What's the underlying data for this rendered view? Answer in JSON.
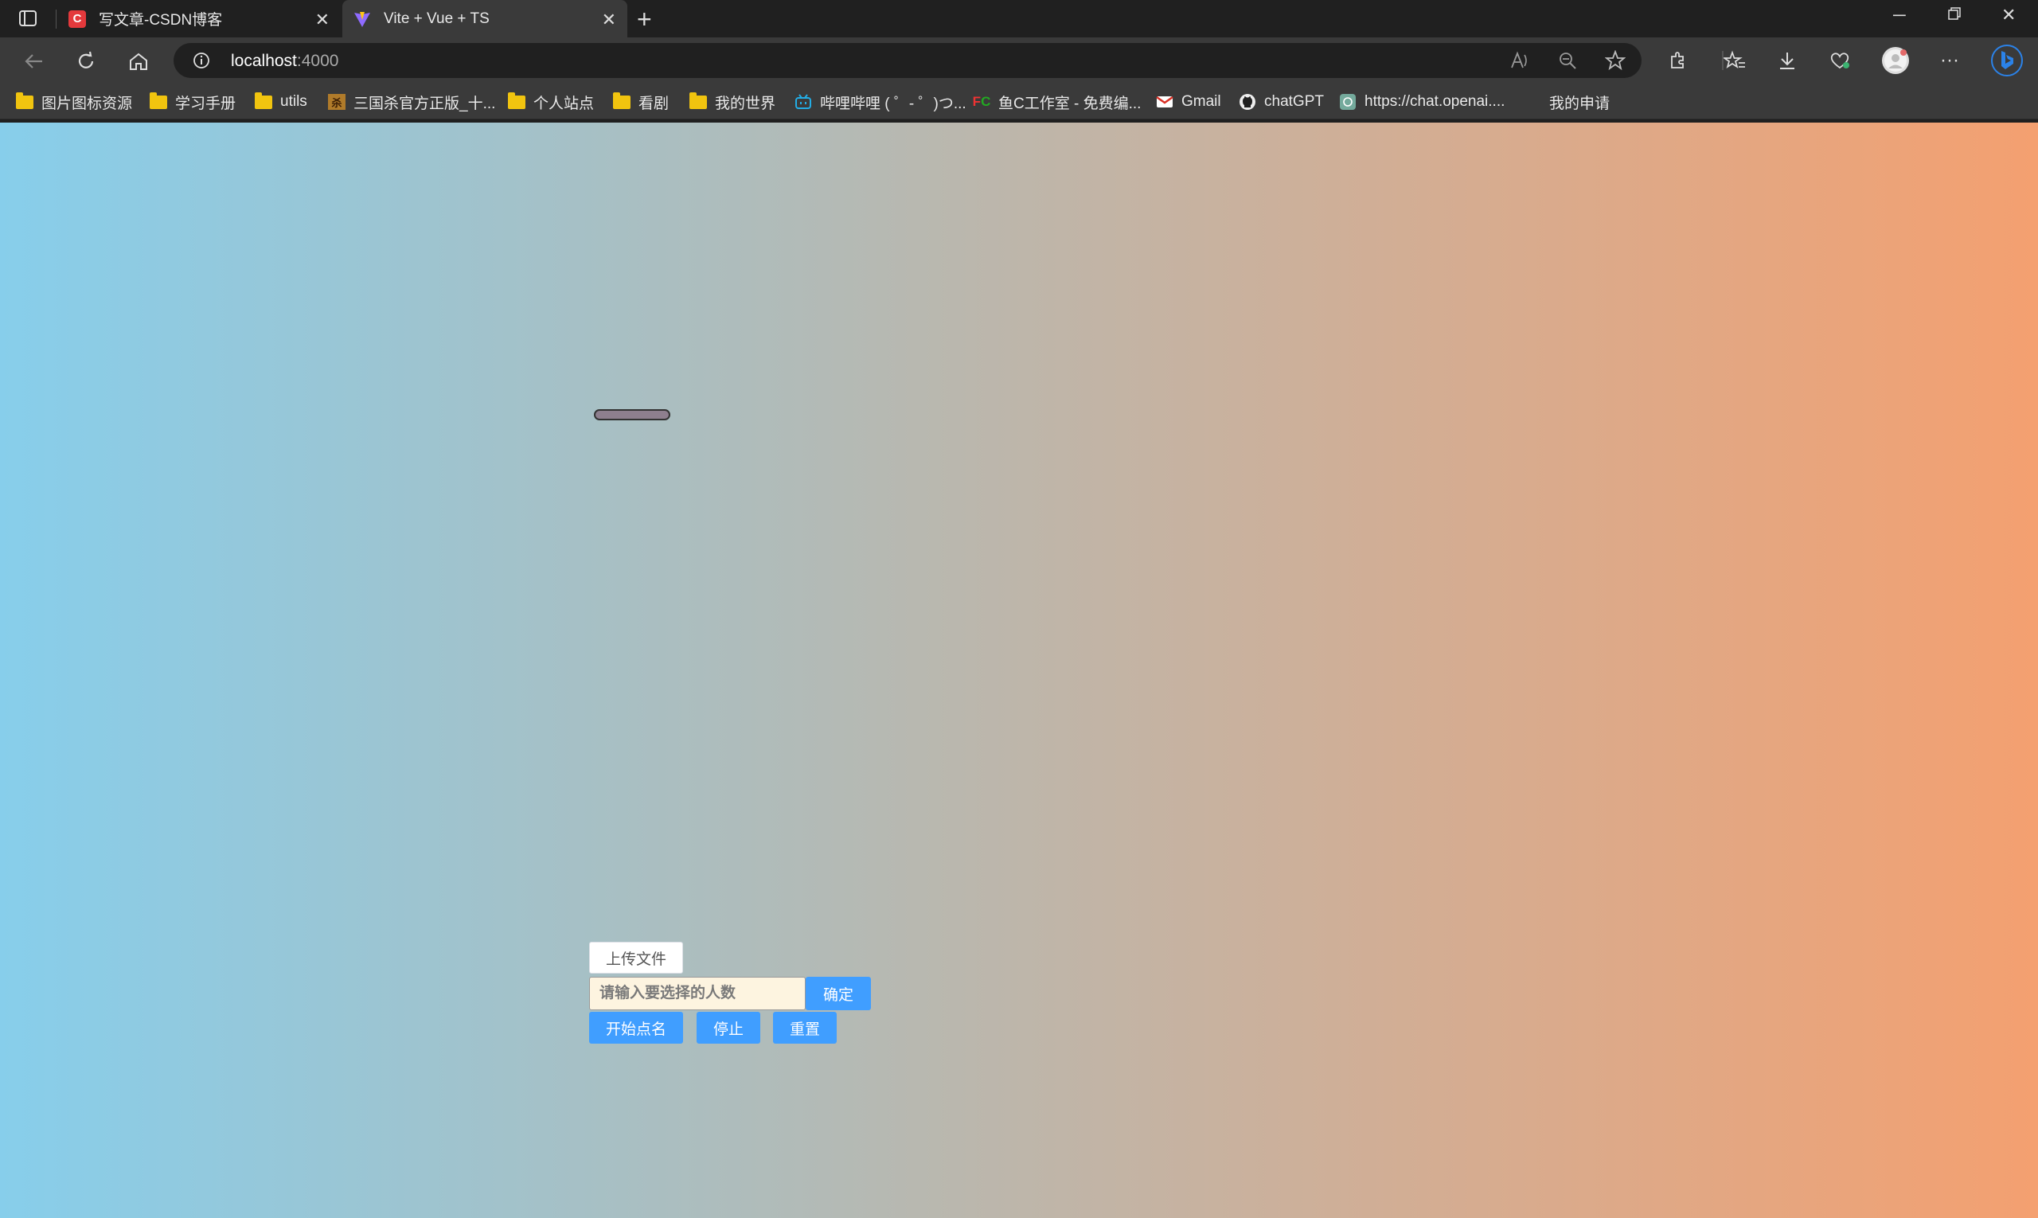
{
  "browser": {
    "tabs": [
      {
        "title": "写文章-CSDN博客",
        "favicon": "C"
      },
      {
        "title": "Vite + Vue + TS"
      }
    ],
    "url_host": "localhost",
    "url_port": ":4000",
    "bookmarks": [
      {
        "label": "图片图标资源",
        "icon": "folder-icon"
      },
      {
        "label": "学习手册",
        "icon": "folder-icon"
      },
      {
        "label": "utils",
        "icon": "folder-icon"
      },
      {
        "label": "三国杀官方正版_十...",
        "icon": "sgs-icon"
      },
      {
        "label": "个人站点",
        "icon": "folder-icon"
      },
      {
        "label": "看剧",
        "icon": "folder-icon"
      },
      {
        "label": "我的世界",
        "icon": "folder-icon"
      },
      {
        "label": "哔哩哔哩 ( ゜- ゜)つ...",
        "icon": "bilibili-icon"
      },
      {
        "label": "鱼C工作室 - 免费编...",
        "icon": "fc-icon"
      },
      {
        "label": "Gmail",
        "icon": "gmail-icon"
      },
      {
        "label": "chatGPT",
        "icon": "github-icon"
      },
      {
        "label": "https://chat.openai....",
        "icon": "openai-icon"
      },
      {
        "label": "我的申请",
        "icon": ""
      }
    ]
  },
  "app": {
    "upload_label": "上传文件",
    "count_placeholder": "请输入要选择的人数",
    "confirm_label": "确定",
    "start_label": "开始点名",
    "stop_label": "停止",
    "reset_label": "重置"
  },
  "colors": {
    "gradient_start": "#87ceeb",
    "gradient_end": "#f4a070",
    "primary_button": "#409eff"
  }
}
